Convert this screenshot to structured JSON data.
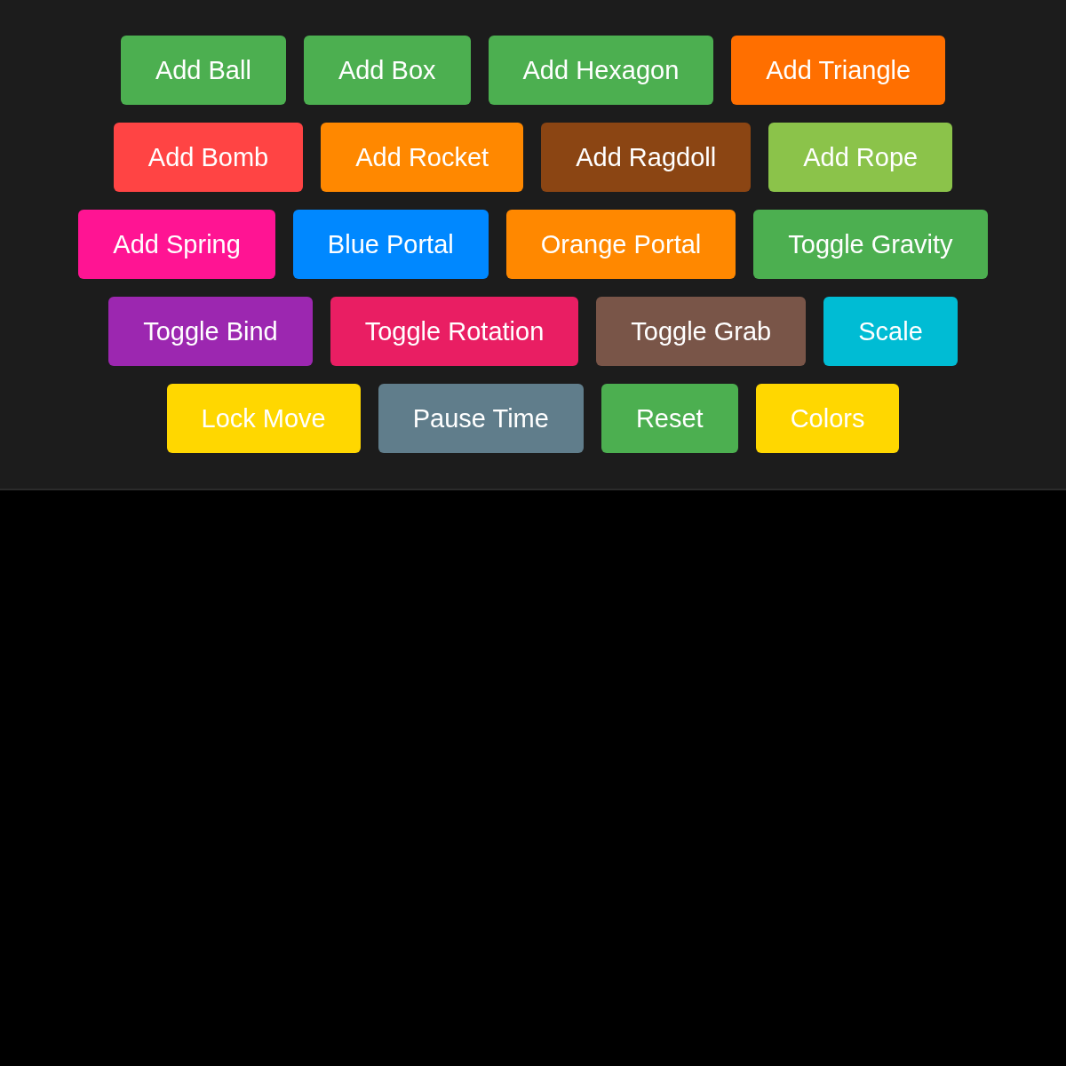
{
  "toolbar": {
    "rows": [
      {
        "buttons": [
          {
            "label": "Add Ball",
            "color": "#4caf50"
          },
          {
            "label": "Add Box",
            "color": "#4caf50"
          },
          {
            "label": "Add Hexagon",
            "color": "#4caf50"
          },
          {
            "label": "Add Triangle",
            "color": "#ff6f00"
          }
        ]
      },
      {
        "buttons": [
          {
            "label": "Add Bomb",
            "color": "#ff4444"
          },
          {
            "label": "Add Rocket",
            "color": "#ff8800"
          },
          {
            "label": "Add Ragdoll",
            "color": "#8b4513"
          },
          {
            "label": "Add Rope",
            "color": "#8bc34a"
          }
        ]
      },
      {
        "buttons": [
          {
            "label": "Add Spring",
            "color": "#ff1493"
          },
          {
            "label": "Blue Portal",
            "color": "#0088ff"
          },
          {
            "label": "Orange Portal",
            "color": "#ff8800"
          },
          {
            "label": "Toggle Gravity",
            "color": "#4caf50"
          }
        ]
      },
      {
        "buttons": [
          {
            "label": "Toggle Bind",
            "color": "#9c27b0"
          },
          {
            "label": "Toggle Rotation",
            "color": "#e91e63"
          },
          {
            "label": "Toggle Grab",
            "color": "#795548"
          },
          {
            "label": "Scale",
            "color": "#00bcd4"
          }
        ]
      },
      {
        "buttons": [
          {
            "label": "Lock Move",
            "color": "#ffd700"
          },
          {
            "label": "Pause Time",
            "color": "#607d8b"
          },
          {
            "label": "Reset",
            "color": "#4caf50"
          },
          {
            "label": "Colors",
            "color": "#ffd700"
          }
        ]
      }
    ]
  }
}
